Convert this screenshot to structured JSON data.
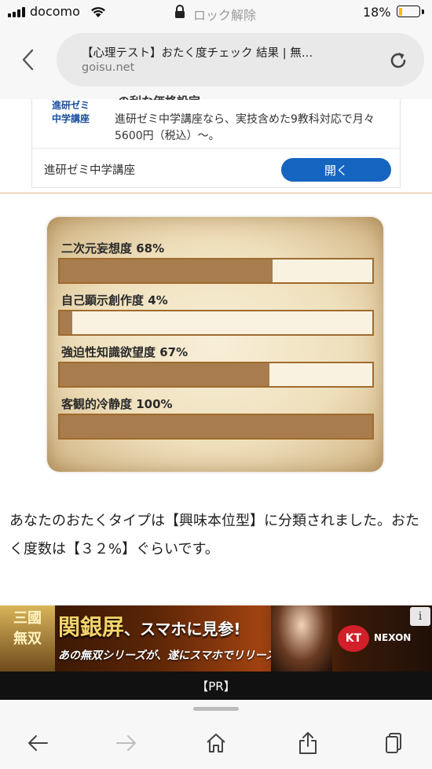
{
  "status_bar": {
    "carrier": "docomo",
    "lock_label": "ロック解除",
    "battery_percent": "18%",
    "battery_level": 0.18
  },
  "browser": {
    "page_title": "【心理テスト】おたく度チェック 結果 | 無…",
    "domain": "goisu.net"
  },
  "ad": {
    "logo_text": "進研ゼミ\n中学講座",
    "headline_fragment": "の利な価格設定",
    "body": "進研ゼミ中学講座なら、実技含めた9教科対応で月々5600円（税込）〜。",
    "advertiser": "進研ゼミ中学講座",
    "open_button": "開く"
  },
  "stats": [
    {
      "label": "二次元妄想度 68%",
      "percent": 68
    },
    {
      "label": "自己顕示創作度 4%",
      "percent": 4
    },
    {
      "label": "強迫性知識欲望度 67%",
      "percent": 67
    },
    {
      "label": "客観的冷静度 100%",
      "percent": 100
    }
  ],
  "result_text": "あなたのおたくタイプは【興味本位型】に分類されました。おたく度数は【３２%】ぐらいです。",
  "banner": {
    "logo_text": "三國\n無双",
    "title": "関銀屏",
    "title_suffix": "、スマホに見参!",
    "subtitle": "あの無双シリーズが、遂にスマホでリリース!",
    "kt_logo": "KT",
    "nexon_logo": "NEXON",
    "info_icon": "i",
    "pr_label": "【PR】"
  },
  "colors": {
    "bar_fill": "#a87c4e",
    "bar_border": "#a06b2e",
    "open_button": "#1565c0",
    "battery": "#f2c200"
  },
  "icons": [
    "wifi-icon",
    "lock-icon",
    "back-chevron-icon",
    "reload-icon",
    "info-icon",
    "back-arrow-icon",
    "forward-arrow-icon",
    "home-icon",
    "share-icon",
    "tabs-icon"
  ]
}
